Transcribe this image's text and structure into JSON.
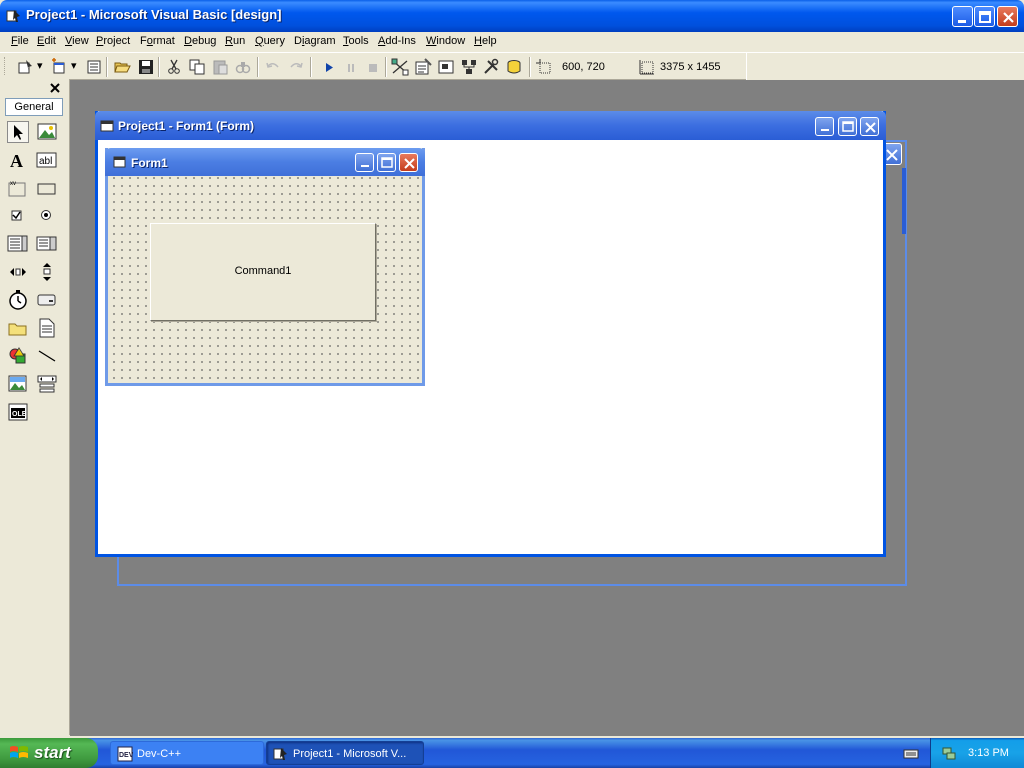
{
  "window": {
    "title": "Project1 - Microsoft Visual Basic [design]"
  },
  "menu": [
    {
      "label": "File",
      "key": "F"
    },
    {
      "label": "Edit",
      "key": "E"
    },
    {
      "label": "View",
      "key": "V"
    },
    {
      "label": "Project",
      "key": "P"
    },
    {
      "label": "Format",
      "key": "o"
    },
    {
      "label": "Debug",
      "key": "D"
    },
    {
      "label": "Run",
      "key": "R"
    },
    {
      "label": "Query",
      "key": "Q"
    },
    {
      "label": "Diagram",
      "key": "i"
    },
    {
      "label": "Tools",
      "key": "T"
    },
    {
      "label": "Add-Ins",
      "key": "A"
    },
    {
      "label": "Window",
      "key": "W"
    },
    {
      "label": "Help",
      "key": "H"
    }
  ],
  "toolbar": {
    "position_readout": "600, 720",
    "size_readout": "3375 x 1455",
    "icons": [
      "add-project-icon",
      "add-form-icon",
      "menu-editor-icon",
      "open-project-icon",
      "save-project-icon",
      "cut-icon",
      "copy-icon",
      "paste-icon",
      "find-icon",
      "undo-icon",
      "redo-icon",
      "start-icon",
      "break-icon",
      "end-icon",
      "project-explorer-icon",
      "properties-window-icon",
      "form-layout-icon",
      "object-browser-icon",
      "toolbox-icon",
      "data-view-icon"
    ]
  },
  "toolbox": {
    "tab_label": "General",
    "tools": [
      "pointer-icon",
      "picturebox-icon",
      "label-icon",
      "textbox-icon",
      "frame-icon",
      "commandbutton-icon",
      "checkbox-icon",
      "optionbutton-icon",
      "combobox-icon",
      "listbox-icon",
      "hscrollbar-icon",
      "vscrollbar-icon",
      "timer-icon",
      "drivelistbox-icon",
      "dirlistbox-icon",
      "filelistbox-icon",
      "shape-icon",
      "line-icon",
      "image-icon",
      "data-icon",
      "ole-icon"
    ]
  },
  "designer": {
    "title": "Project1 - Form1 (Form)"
  },
  "form": {
    "title": "Form1",
    "command_caption": "Command1"
  },
  "taskbar": {
    "start_label": "start",
    "tasks": [
      {
        "label": "Dev-C++",
        "active": false
      },
      {
        "label": "Project1 - Microsoft V...",
        "active": true
      }
    ],
    "clock": "3:13 PM"
  },
  "colors": {
    "xp_blue": "#0058ee",
    "workspace_gray": "#808080",
    "chrome": "#ece9d8",
    "start_green": "#3f9a3f"
  }
}
